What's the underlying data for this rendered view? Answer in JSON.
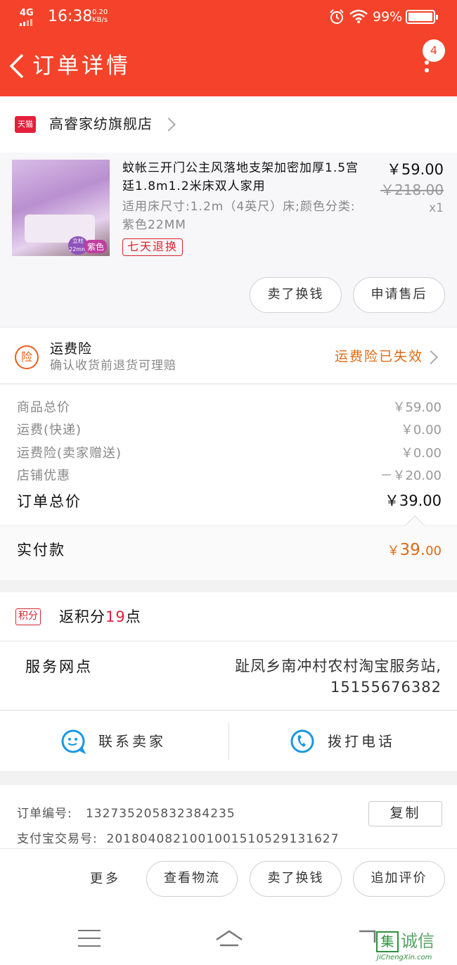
{
  "status_bar": {
    "network": "4G",
    "time": "16:38",
    "speed_value": "0.20",
    "speed_unit": "KB/s",
    "battery": "99%"
  },
  "header": {
    "title": "订单详情",
    "badge_count": "4",
    "color": "#f4432a"
  },
  "shop": {
    "logo_text": "天猫",
    "name": "高睿家纺旗舰店"
  },
  "product": {
    "title": "蚊帐三开门公主风落地支架加密加厚1.5宫廷1.8m1.2米床双人家用",
    "spec": "适用床尺寸:1.2m（4英尺）床;颜色分类:紫色22MM",
    "image_tag_1": "立柱22mm",
    "image_tag_2": "紫色",
    "return_tag": "七天退换",
    "price": "￥59.00",
    "original_price": "￥218.00",
    "quantity": "x1",
    "buttons": [
      "卖了换钱",
      "申请售后"
    ]
  },
  "insurance": {
    "icon_text": "险",
    "title": "运费险",
    "subtitle": "确认收货前退货可理赔",
    "status": "运费险已失效"
  },
  "fees": [
    {
      "label": "商品总价",
      "value": "￥59.00"
    },
    {
      "label": "运费(快递)",
      "value": "￥0.00"
    },
    {
      "label": "运费险(卖家赠送)",
      "value": "￥0.00"
    },
    {
      "label": "店铺优惠",
      "value": "－￥20.00"
    }
  ],
  "order_total": {
    "label": "订单总价",
    "value": "￥39.00"
  },
  "paid": {
    "label": "实付款",
    "currency": "￥",
    "amount": "39.",
    "cents": "00"
  },
  "points": {
    "tag": "积分",
    "prefix": "返积分",
    "value": "19",
    "suffix": "点"
  },
  "service": {
    "label": "服务网点",
    "value_line1": "趾凤乡南冲村农村淘宝服务站,",
    "value_line2": "15155676382"
  },
  "contact": {
    "seller": "联系卖家",
    "phone": "拨打电话"
  },
  "order_info": {
    "order_no_label": "订单编号:",
    "order_no": "132735205832384235",
    "alipay_label": "支付宝交易号:",
    "alipay_no": "2018040821001001510529131627",
    "copy_label": "复制"
  },
  "action_bar": {
    "more": "更多",
    "buttons": [
      "查看物流",
      "卖了换钱",
      "追加评价"
    ]
  },
  "watermark": {
    "box": "集",
    "text": "诚信",
    "domain": "JiChengXin.com"
  }
}
